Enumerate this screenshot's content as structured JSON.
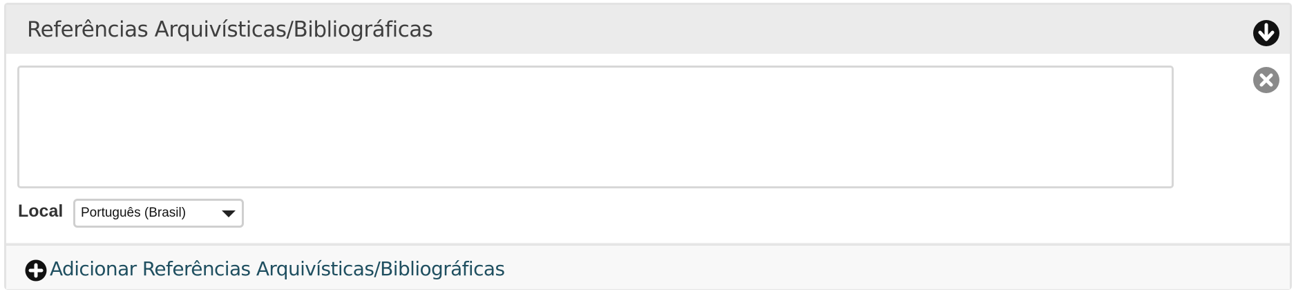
{
  "panel": {
    "title": "Referências Arquivísticas/Bibliográficas",
    "toggle_icon": "arrow-down-circle-icon"
  },
  "field": {
    "textarea_value": "",
    "remove_icon": "close-circle-icon",
    "local_label": "Local",
    "local_select_value": "Português (Brasil)"
  },
  "footer": {
    "add_icon": "plus-circle-icon",
    "add_label": "Adicionar Referências Arquivísticas/Bibliográficas"
  },
  "colors": {
    "header_bg": "#ebebeb",
    "body_bg": "#ffffff",
    "footer_bg": "#f8f8f8",
    "title_text": "#3f3f3f",
    "link_text": "#1f4f60",
    "remove_icon": "#8a8a8a",
    "dark_icon": "#111111"
  }
}
